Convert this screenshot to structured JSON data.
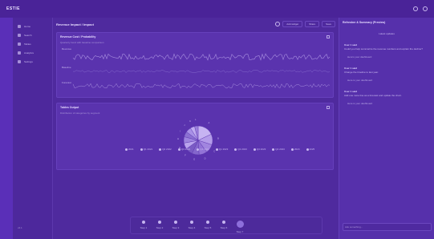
{
  "app": {
    "brand": "ESTIE"
  },
  "sidebar": {
    "items": [
      {
        "label": "Home"
      },
      {
        "label": "Search"
      },
      {
        "label": "Tables"
      },
      {
        "label": "Analytics"
      },
      {
        "label": "Settings"
      }
    ],
    "footer": "v2.1"
  },
  "main": {
    "title": "Revenue Impact / Impact",
    "actions": [
      "Add widget",
      "Share",
      "Save"
    ]
  },
  "panels": [
    {
      "title": "Revenue Cost / Probability",
      "subtitle": "Quarterly trend with baseline comparison",
      "rows": [
        "Revenue",
        "Baseline",
        "Forecast"
      ]
    },
    {
      "title": "Tables Output",
      "subtitle": "Distribution of categories by segment",
      "chart_data": {
        "type": "pie",
        "categories": [
          "A",
          "B",
          "C",
          "D",
          "E",
          "F",
          "G",
          "H",
          "I",
          "J",
          "K",
          "L"
        ],
        "values": [
          18,
          12,
          10,
          9,
          8,
          8,
          7,
          7,
          6,
          6,
          5,
          4
        ]
      },
      "legend": [
        "2021",
        "Q1 2021",
        "Q2 2022",
        "Q3 2022",
        "Q4 2022",
        "Q1 2023",
        "Q2 2023",
        "Q3 2023",
        "Q4 2023",
        "2024",
        "2025"
      ]
    }
  ],
  "timeline": [
    "Step 1",
    "Step 2",
    "Step 3",
    "Step 4",
    "Step 5",
    "Step 6",
    "Step 7"
  ],
  "assistant": {
    "title": "Refresher & Summary (Preview)",
    "pill": "Latest updates",
    "messages": [
      {
        "who": "User 1 said",
        "text": "Could you help summarize the revenue numbers and explain the decline?"
      },
      {
        "who": "Assistant",
        "text": "Here's your dashboard"
      },
      {
        "who": "User 1 said",
        "text": "Change the timeline to last year."
      },
      {
        "who": "Assistant",
        "text": "Here is your dashboard"
      },
      {
        "who": "User 1 said",
        "text": "Add one more line as a forecast and update the chart."
      },
      {
        "who": "Assistant",
        "text": "Here is your dashboard"
      }
    ],
    "compose_placeholder": "Ask something..."
  },
  "colors": {
    "accent": "#8d6fdb",
    "background": "#4f2a9e"
  }
}
